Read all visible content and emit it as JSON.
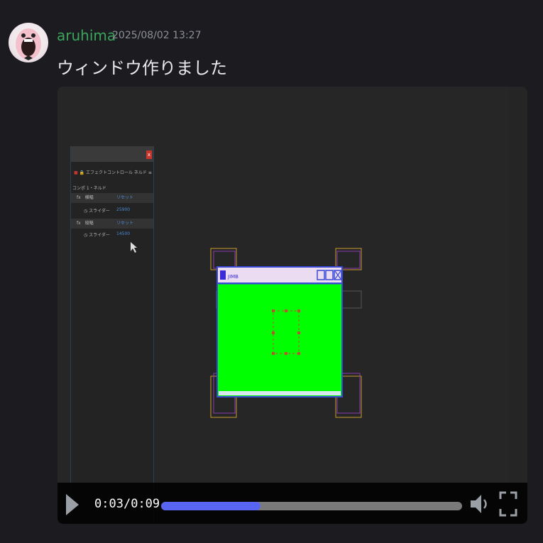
{
  "post": {
    "username": "aruhima",
    "timestamp": "2025/08/02 13:27",
    "message": "ウィンドウ作りました",
    "avatar_icon": "avatar-icon"
  },
  "editor_panel": {
    "close_label": "x",
    "tab_label": "エフェクトコントロール ネルド",
    "menu_glyph": "≡",
    "comp_label": "コンポ 1・ネルド",
    "effects": [
      {
        "fx": "fx",
        "name": "横幅",
        "reset": "リセット",
        "slider_label": "スライダー",
        "slider_value": "25900"
      },
      {
        "fx": "fx",
        "name": "縦幅",
        "reset": "リセット",
        "slider_label": "スライダー",
        "slider_value": "14500"
      }
    ]
  },
  "window_preview": {
    "title": "JIMB",
    "body_color": "#00ff00",
    "frame_color": "#3a4ad8",
    "titlebar_color": "#ecdcf2"
  },
  "player": {
    "current_time": "0:03",
    "separator": "/",
    "duration": "0:09",
    "progress": 0.33,
    "accent": "#5865f2",
    "play_icon": "play-icon",
    "volume_icon": "volume-icon",
    "fullscreen_icon": "fullscreen-icon"
  }
}
